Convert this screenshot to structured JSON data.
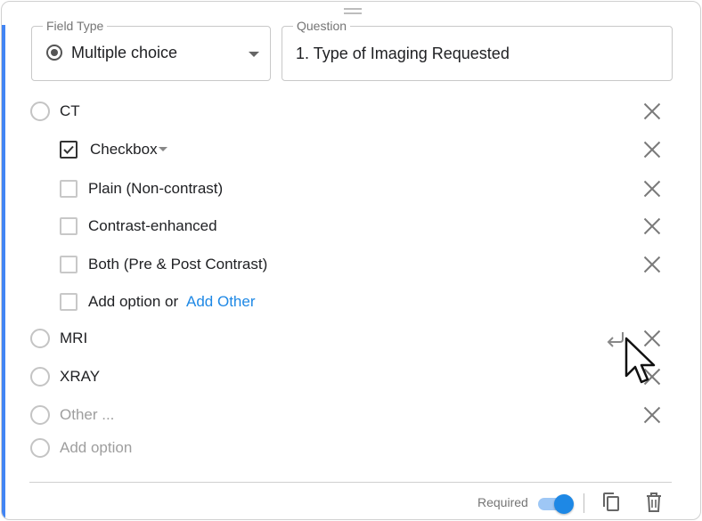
{
  "field_type": {
    "legend": "Field Type",
    "value": "Multiple choice"
  },
  "question": {
    "legend": "Question",
    "value": "1. Type of Imaging Requested"
  },
  "options": [
    {
      "label": "CT"
    },
    {
      "label": "MRI"
    },
    {
      "label": "XRAY"
    }
  ],
  "sub_question": {
    "type_label": "Checkbox",
    "options": [
      {
        "label": "Plain (Non-contrast)"
      },
      {
        "label": "Contrast-enhanced"
      },
      {
        "label": "Both (Pre & Post Contrast)"
      }
    ],
    "add_option": "Add option or",
    "add_other": "Add Other"
  },
  "other_placeholder": "Other ...",
  "add_option": "Add option",
  "footer": {
    "required_label": "Required",
    "required_on": true
  },
  "colors": {
    "accent": "#4285f4",
    "link": "#1e88e5",
    "toggle": "#1e88e5"
  }
}
